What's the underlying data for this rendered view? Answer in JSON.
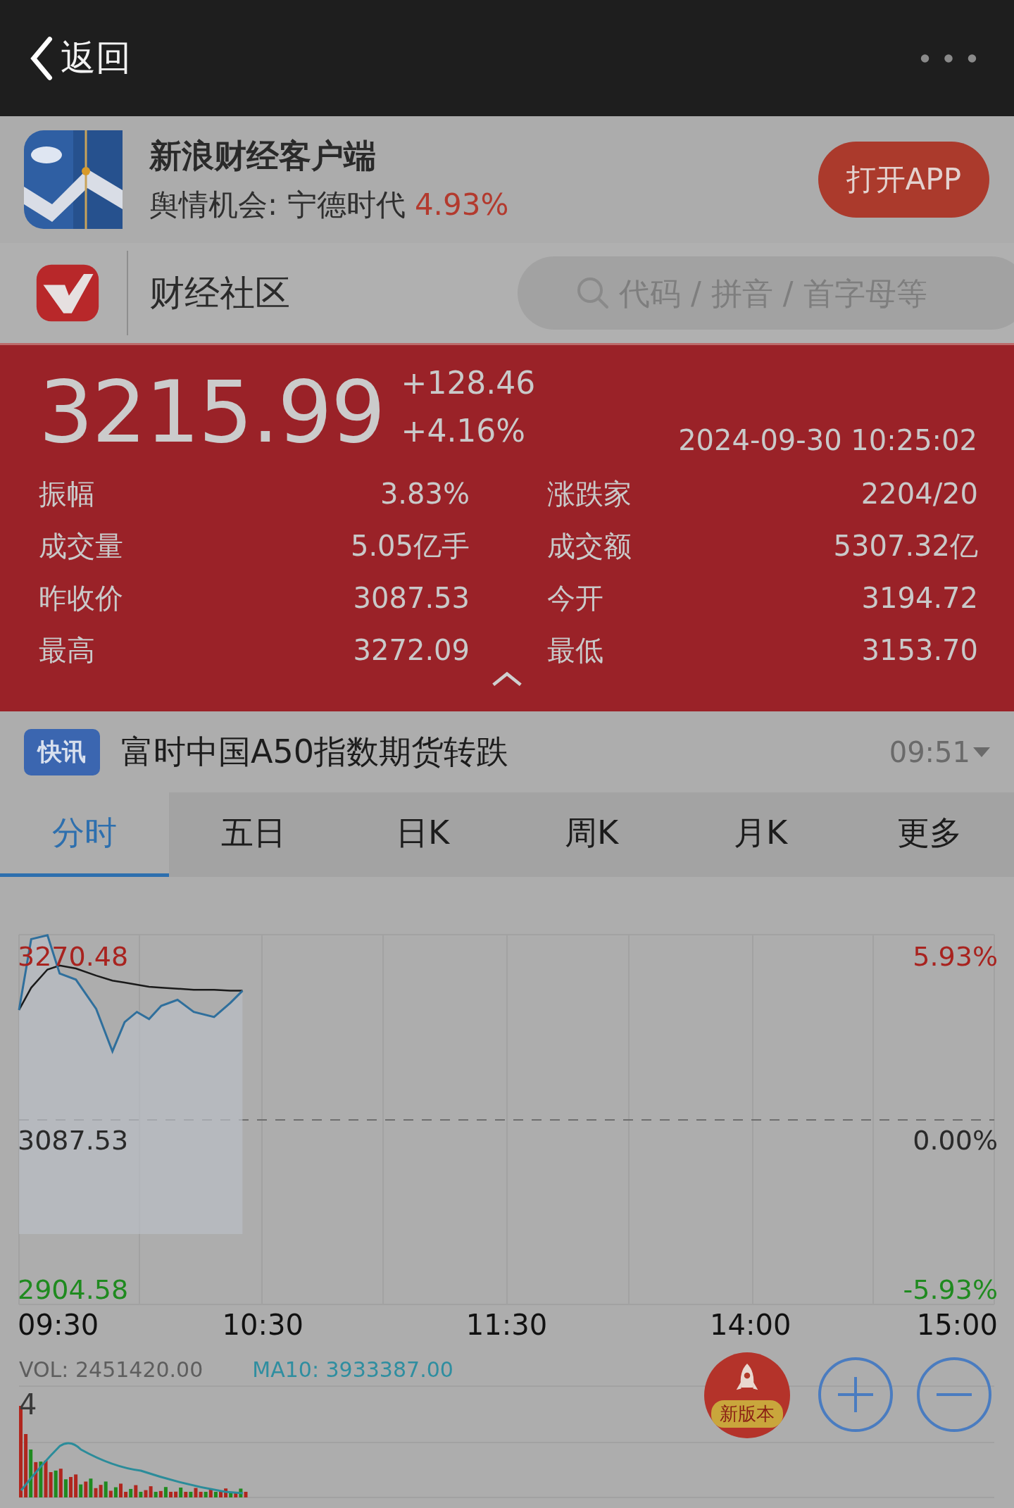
{
  "top_bar": {
    "back_label": "返回"
  },
  "app_banner": {
    "title": "新浪财经客户端",
    "subtitle": "舆情机会: 宁德时代",
    "subtitle_change": "4.93%",
    "button": "打开APP"
  },
  "community_bar": {
    "title": "财经社区",
    "search": {
      "placeholder": "代码 / 拼音 / 首字母等"
    }
  },
  "quote": {
    "price": "3215.99",
    "change": "+128.46",
    "change_pct": "+4.16%",
    "timestamp": "2024-09-30 10:25:02",
    "stats": [
      {
        "label": "振幅",
        "value": "3.83%"
      },
      {
        "label": "涨跌家",
        "value": "2204/20"
      },
      {
        "label": "成交量",
        "value": "5.05亿手"
      },
      {
        "label": "成交额",
        "value": "5307.32亿"
      },
      {
        "label": "昨收价",
        "value": "3087.53"
      },
      {
        "label": "今开",
        "value": "3194.72"
      },
      {
        "label": "最高",
        "value": "3272.09"
      },
      {
        "label": "最低",
        "value": "3153.70"
      }
    ]
  },
  "news": {
    "tag": "快讯",
    "headline": "富时中国A50指数期货转跌",
    "time": "09:51"
  },
  "tabs": [
    {
      "label": "分时",
      "selected": true
    },
    {
      "label": "五日",
      "selected": false
    },
    {
      "label": "日K",
      "selected": false
    },
    {
      "label": "周K",
      "selected": false
    },
    {
      "label": "月K",
      "selected": false
    },
    {
      "label": "更多",
      "selected": false
    }
  ],
  "chart": {
    "price_labels": [
      "3270.48",
      "3087.53",
      "2904.58"
    ],
    "percent_labels": [
      "5.93%",
      "0.00%",
      "-5.93%"
    ],
    "time_labels": [
      "09:30",
      "10:30",
      "11:30",
      "14:00",
      "15:00"
    ]
  },
  "volume": {
    "vol": "VOL: 2451420.00",
    "ma10": "MA10: 3933387.00",
    "axis_label": "4"
  },
  "floating_buttons": {
    "new_version": "新版本"
  }
}
